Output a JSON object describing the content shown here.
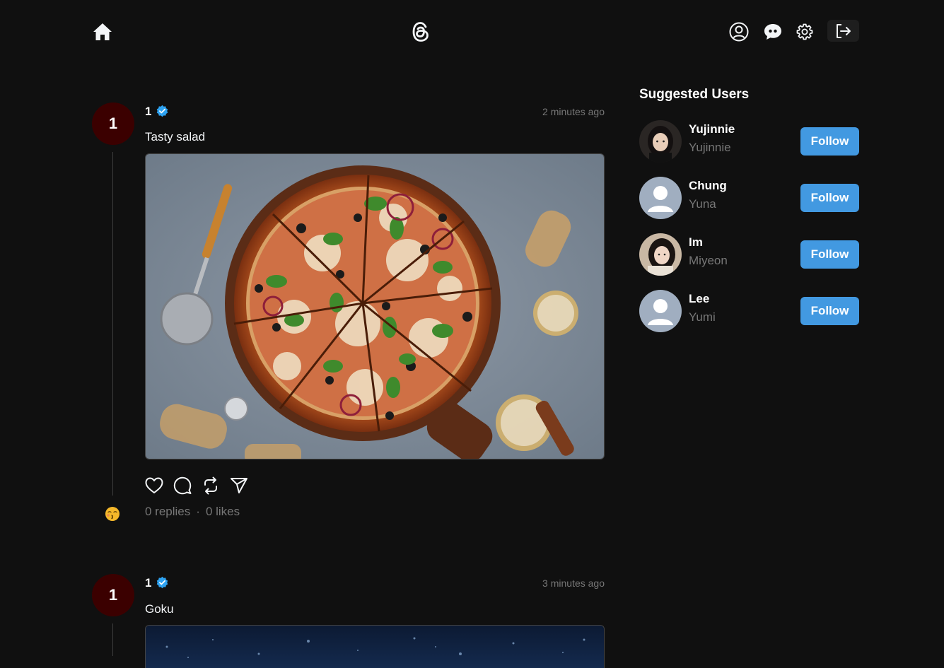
{
  "header": {
    "icons": [
      "home-icon",
      "threads-logo",
      "user-profile-icon",
      "chat-icon",
      "settings-icon",
      "logout-icon"
    ]
  },
  "posts": [
    {
      "avatar_text": "1",
      "username": "1",
      "time": "2 minutes ago",
      "text": "Tasty salad",
      "replies": "0 replies",
      "likes": "0 likes",
      "dot": "·"
    },
    {
      "avatar_text": "1",
      "username": "1",
      "time": "3 minutes ago",
      "text": "Goku"
    }
  ],
  "suggested": {
    "title": "Suggested Users",
    "users": [
      {
        "name": "Yujinnie",
        "handle": "Yujinnie",
        "follow": "Follow"
      },
      {
        "name": "Chung",
        "handle": "Yuna",
        "follow": "Follow"
      },
      {
        "name": "Im",
        "handle": "Miyeon",
        "follow": "Follow"
      },
      {
        "name": "Lee",
        "handle": "Yumi",
        "follow": "Follow"
      }
    ]
  },
  "colors": {
    "background": "#101010",
    "accent": "#4299e1",
    "avatar": "#3b0000",
    "muted": "#777777"
  }
}
